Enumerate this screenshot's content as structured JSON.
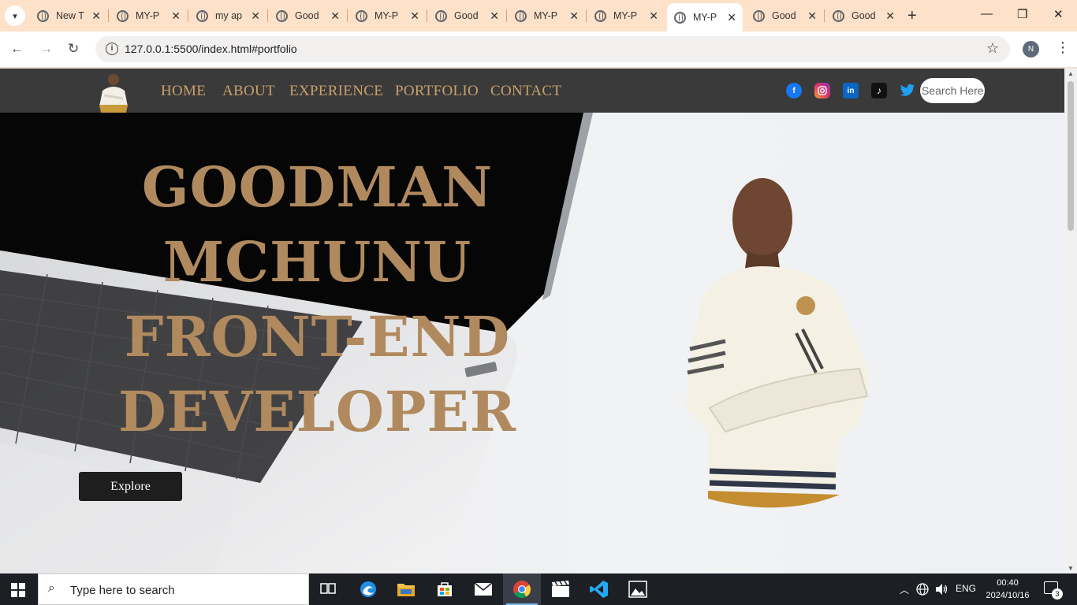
{
  "browser": {
    "tabs": [
      {
        "title": "New T"
      },
      {
        "title": "MY-P"
      },
      {
        "title": "my ap"
      },
      {
        "title": "Good"
      },
      {
        "title": "MY-P"
      },
      {
        "title": "Good"
      },
      {
        "title": "MY-P"
      },
      {
        "title": "MY-P"
      },
      {
        "title": "MY-P",
        "active": true
      },
      {
        "title": "Good"
      },
      {
        "title": "Good"
      }
    ],
    "url": "127.0.0.1:5500/index.html#portfolio",
    "profile_initial": "N"
  },
  "site": {
    "nav": {
      "links": [
        "HOME",
        "ABOUT",
        "EXPERIENCE",
        "PORTFOLIO",
        "CONTACT"
      ],
      "search_placeholder": "Search Here",
      "social_icons": [
        "facebook-icon",
        "instagram-icon",
        "linkedin-icon",
        "tiktok-icon",
        "twitter-icon"
      ]
    },
    "hero": {
      "lines": [
        "GOODMAN",
        "MCHUNU",
        "FRONT-END",
        "DEVELOPER"
      ],
      "button_label": "Explore"
    },
    "colors": {
      "accent": "#b08a5e",
      "nav_bg": "#3a3a3a",
      "nav_link": "#c8a06b",
      "button_bg": "#1e1e1e"
    }
  },
  "taskbar": {
    "search_placeholder": "Type here to search",
    "language": "ENG",
    "time": "00:40",
    "date": "2024/10/16",
    "notification_count": "3"
  }
}
